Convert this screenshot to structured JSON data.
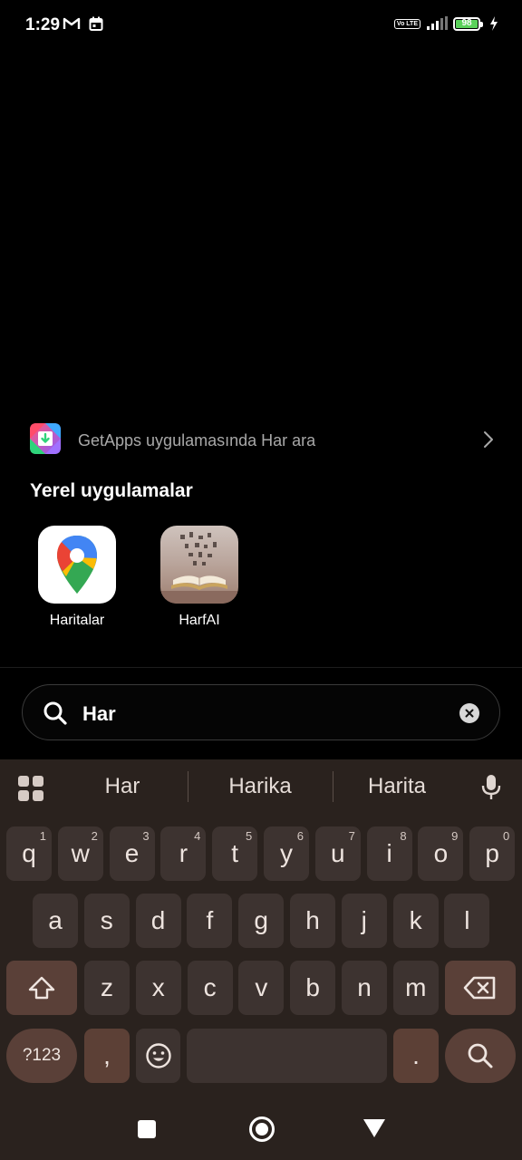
{
  "status_bar": {
    "time": "1:29",
    "battery": "98",
    "network_badge": "Vo LTE",
    "icons": [
      "gmail-icon",
      "calendar-icon",
      "volte-icon",
      "signal-icon",
      "battery-icon",
      "charging-icon"
    ]
  },
  "getapps": {
    "text": "GetApps uygulamasında Har ara",
    "icon": "getapps-icon"
  },
  "local_apps": {
    "title": "Yerel uygulamalar",
    "apps": [
      {
        "label": "Haritalar",
        "icon": "google-maps-icon"
      },
      {
        "label": "HarfAI",
        "icon": "harfai-icon"
      }
    ]
  },
  "search": {
    "query": "Har",
    "icon": "search-icon",
    "clear_icon": "clear-icon"
  },
  "keyboard": {
    "suggestions": [
      "Har",
      "Harika",
      "Harita"
    ],
    "row1": [
      {
        "k": "q",
        "h": "1"
      },
      {
        "k": "w",
        "h": "2"
      },
      {
        "k": "e",
        "h": "3"
      },
      {
        "k": "r",
        "h": "4"
      },
      {
        "k": "t",
        "h": "5"
      },
      {
        "k": "y",
        "h": "6"
      },
      {
        "k": "u",
        "h": "7"
      },
      {
        "k": "i",
        "h": "8"
      },
      {
        "k": "o",
        "h": "9"
      },
      {
        "k": "p",
        "h": "0"
      }
    ],
    "row2": [
      "a",
      "s",
      "d",
      "f",
      "g",
      "h",
      "j",
      "k",
      "l"
    ],
    "row3": [
      "z",
      "x",
      "c",
      "v",
      "b",
      "n",
      "m"
    ],
    "symbols_key": "?123",
    "comma_key": ",",
    "period_key": "."
  },
  "colors": {
    "background": "#000000",
    "keyboard_bg": "#2a221e",
    "key_bg": "#3d3330",
    "function_key_bg": "#5a4038",
    "battery_fill": "#5ad25a"
  }
}
